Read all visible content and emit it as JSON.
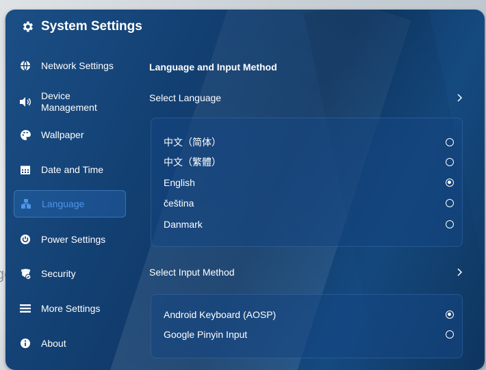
{
  "background": {
    "partial_text": "ge"
  },
  "app": {
    "title": "System Settings",
    "icon": "gear-icon"
  },
  "sidebar": {
    "items": [
      {
        "label": "Network Settings",
        "icon": "globe-icon"
      },
      {
        "label": "Device Management",
        "line1": "Device",
        "line2": "Management",
        "icon": "speaker-icon"
      },
      {
        "label": "Wallpaper",
        "icon": "palette-icon"
      },
      {
        "label": "Date and Time",
        "icon": "calendar-icon"
      },
      {
        "label": "Language",
        "icon": "language-icon",
        "active": true
      },
      {
        "label": "Power Settings",
        "icon": "power-icon"
      },
      {
        "label": "Security",
        "icon": "security-icon"
      },
      {
        "label": "More Settings",
        "icon": "menu-icon"
      },
      {
        "label": "About",
        "icon": "info-icon"
      }
    ]
  },
  "main": {
    "section_title": "Language and Input Method",
    "select_language_label": "Select Language",
    "languages": [
      {
        "label": "中文（简体）",
        "selected": false
      },
      {
        "label": "中文（繁體）",
        "selected": false
      },
      {
        "label": "English",
        "selected": true
      },
      {
        "label": "čeština",
        "selected": false
      },
      {
        "label": "Danmark",
        "selected": false
      }
    ],
    "select_input_label": "Select Input Method",
    "input_methods": [
      {
        "label": "Android Keyboard (AOSP)",
        "selected": true
      },
      {
        "label": "Google Pinyin Input",
        "selected": false
      }
    ]
  },
  "colors": {
    "accent": "#4f95e8",
    "panel": "#123e70",
    "text": "#ffffff"
  }
}
